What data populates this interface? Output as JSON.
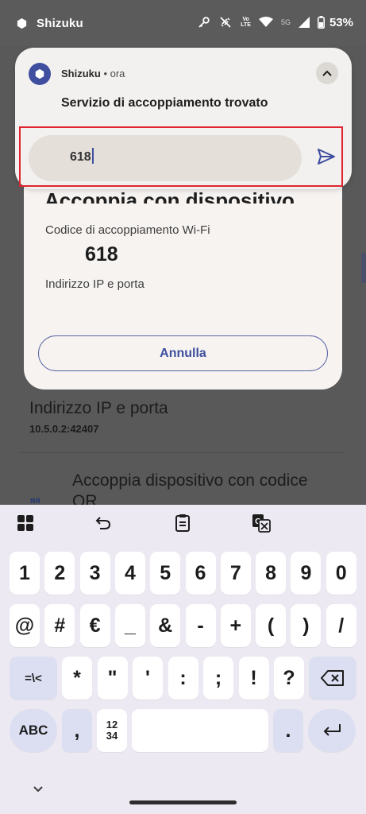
{
  "status_bar": {
    "app_name": "Shizuku",
    "lte_top": "Vo",
    "lte_bottom": "LTE",
    "network": "5G",
    "battery": "53%"
  },
  "background": {
    "row_title": "Indirizzo IP e porta",
    "row_subtitle": "10.5.0.2:42407",
    "qr_title": "Accoppia dispositivo con codice QR",
    "qr_icon_text": "ᴙᴙ"
  },
  "dialog": {
    "title": "Accoppia con dispositivo",
    "code_label": "Codice di accoppiamento Wi-Fi",
    "code_value": "618",
    "ip_label": "Indirizzo IP e porta",
    "cancel_label": "Annulla"
  },
  "notification": {
    "app_name": "Shizuku",
    "time": " • ora",
    "title": "Servizio di accoppiamento trovato",
    "input_value": "618"
  },
  "keyboard": {
    "row1": [
      "1",
      "2",
      "3",
      "4",
      "5",
      "6",
      "7",
      "8",
      "9",
      "0"
    ],
    "row2": [
      "@",
      "#",
      "€",
      "_",
      "&",
      "-",
      "+",
      "(",
      ")",
      "/"
    ],
    "row3": [
      "*",
      "\"",
      "'",
      ":",
      ";",
      "!",
      "?"
    ],
    "alt_symbols": "=\\<",
    "abc": "ABC",
    "comma": ",",
    "num_top": "12",
    "num_bottom": "34",
    "period": "."
  },
  "colors": {
    "accent": "#3f4e9f",
    "highlight": "#e0242f"
  }
}
